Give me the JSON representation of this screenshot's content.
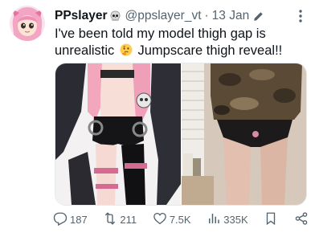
{
  "tweet": {
    "display_name": "PPslayer",
    "badge_icon": "skull-icon",
    "handle": "@ppslayer_vt",
    "separator": "·",
    "date": "13 Jan",
    "edit_icon": "pencil-icon",
    "more_icon": "more-options-icon",
    "text_part1": "I've been told my model thigh gap is unrealistic",
    "emoji_icon": "thinking-face-icon",
    "text_part2": "Jumpscare thigh reveal!!",
    "media": [
      {
        "kind": "image",
        "subject": "pink-haired vtuber model"
      },
      {
        "kind": "image",
        "subject": "real-life photo"
      }
    ]
  },
  "actions": {
    "replies": "187",
    "retweets": "211",
    "likes": "7.5K",
    "views": "335K",
    "icons": {
      "reply": "reply-icon",
      "retweet": "retweet-icon",
      "like": "heart-icon",
      "views": "views-chart-icon",
      "bookmark": "bookmark-icon",
      "share": "share-icon"
    }
  },
  "colors": {
    "text": "#0f1419",
    "secondary": "#536471",
    "accent": "#1d9bf0"
  }
}
